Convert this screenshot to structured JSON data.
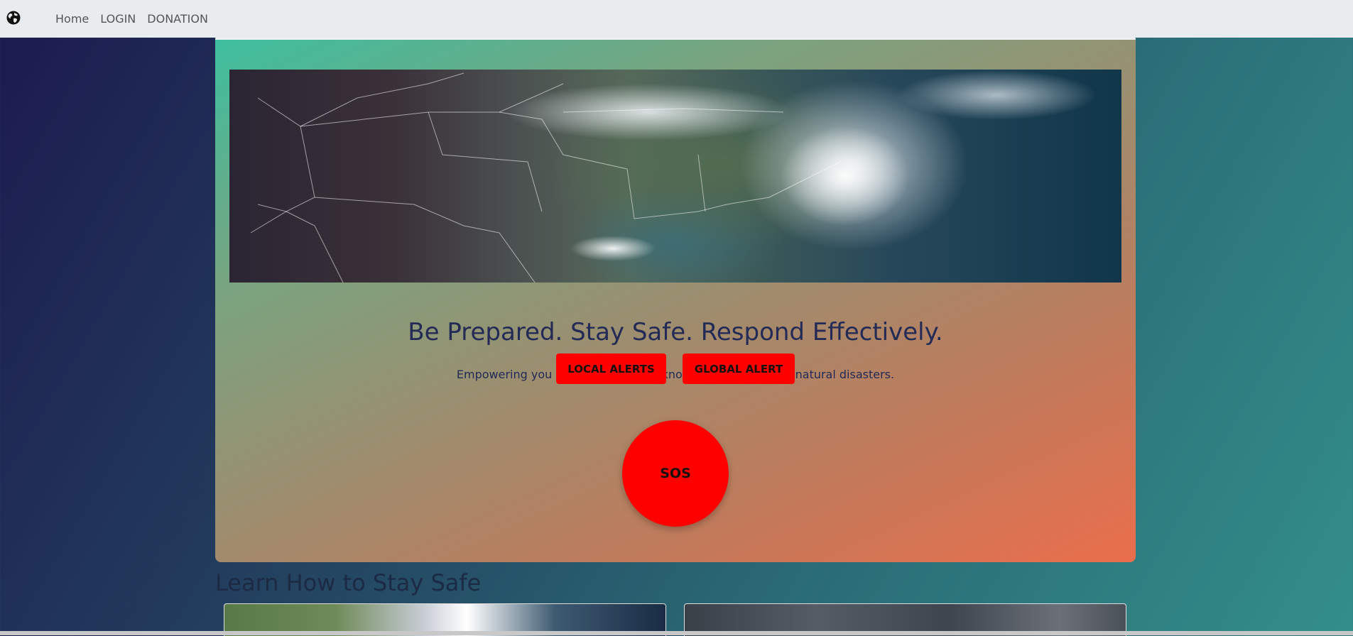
{
  "nav": {
    "links": [
      {
        "label": "Home"
      },
      {
        "label": "LOGIN"
      },
      {
        "label": "DONATION"
      }
    ],
    "logo_icon": "globe-icon"
  },
  "hero": {
    "image_alt": "Satellite image of a hurricane over the southeastern United States",
    "headline": "Be Prepared. Stay Safe. Respond Effectively.",
    "subline": "Empowering you with the tools and knowledge to navigate natural disasters.",
    "local_alerts_label": "LOCAL ALERTS",
    "global_alert_label": "GLOBAL ALERT",
    "sos_label": "SOS"
  },
  "learn": {
    "title": "Learn How to Stay Safe"
  },
  "colors": {
    "alert_red": "#ff0000",
    "heading_navy": "#222a55",
    "nav_bg": "#e9ecef"
  }
}
